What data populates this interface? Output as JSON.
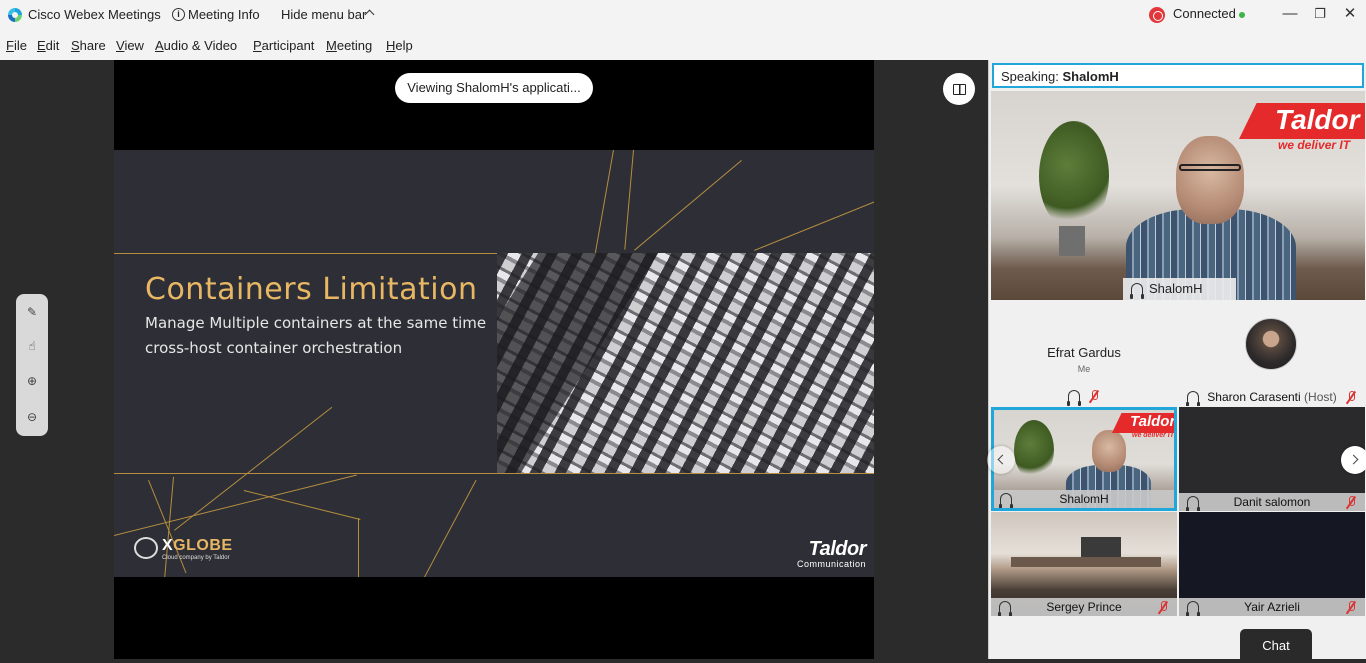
{
  "titlebar": {
    "app_name": "Cisco Webex Meetings",
    "meeting_info": "Meeting Info",
    "hide_menu": "Hide menu bar",
    "status": "Connected",
    "minimize": "—",
    "restore": "❐",
    "close": "✕"
  },
  "menu": {
    "file_u": "F",
    "file_rest": "ile",
    "edit_u": "E",
    "edit_rest": "dit",
    "share_u": "S",
    "share_rest": "hare",
    "view_u": "V",
    "view_rest": "iew",
    "audio_u": "A",
    "audio_rest": "udio & Video",
    "participant_u": "P",
    "participant_rest": "articipant",
    "meeting_u": "M",
    "meeting_rest": "eeting",
    "help_u": "H",
    "help_rest": "elp"
  },
  "stage": {
    "viewing_pill": "Viewing ShalomH's applicati...",
    "slide": {
      "title": "Containers Limitation",
      "bullets": [
        "Manage Multiple containers at the same time",
        "cross-host container orchestration"
      ],
      "logo_left_x": "X",
      "logo_left_rest": "GLOBE",
      "logo_left_sub": "Cloud company by Taldor",
      "logo_right": "Taldor",
      "logo_right_sub": "Communication"
    }
  },
  "panel": {
    "speaking_label": "Speaking:",
    "speaking_name": "ShalomH",
    "active_name": "ShalomH",
    "active_logo": "Taldor",
    "active_logo_sub": "we deliver IT",
    "participants": [
      {
        "name": "Efrat Gardus",
        "sub": "Me"
      },
      {
        "name": "Sharon Carasenti",
        "role": "(Host)"
      },
      {
        "name": "ShalomH",
        "logo": "Taldor",
        "logo_sub": "we deliver IT"
      },
      {
        "name": "Danit salomon"
      },
      {
        "name": "Sergey Prince"
      },
      {
        "name": "Yair Azrieli"
      }
    ],
    "chat": "Chat"
  },
  "colors": {
    "accent": "#20a6d8",
    "slide_gold": "#e8b764",
    "taldor_red": "#e42a2a",
    "connected_green": "#3cb44a"
  }
}
